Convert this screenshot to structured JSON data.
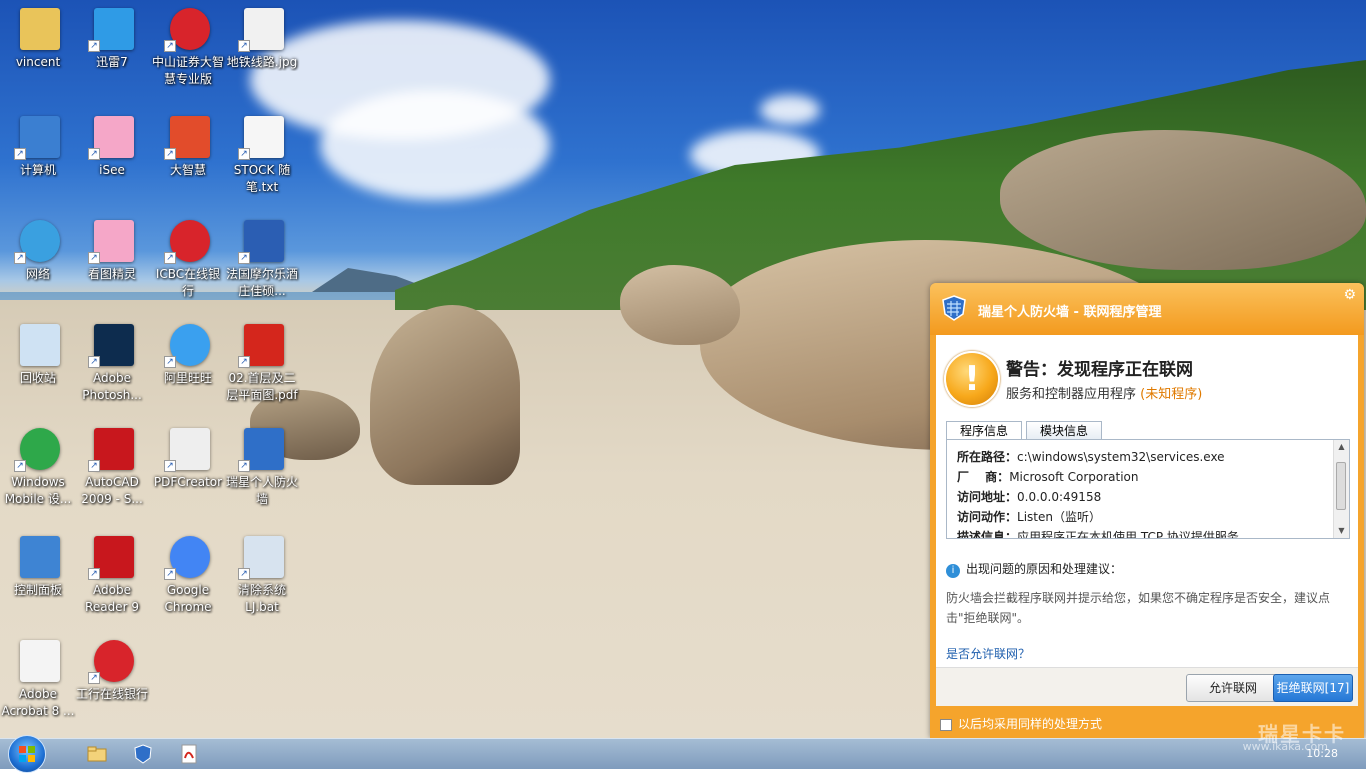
{
  "desktop": {
    "icons": [
      {
        "label": "vincent",
        "icon": "user-folder-icon"
      },
      {
        "label": "迅雷7",
        "icon": "thunder-bird-icon"
      },
      {
        "label": "中山证券大智慧专业版",
        "icon": "stock-app-icon"
      },
      {
        "label": "地铁线路.jpg",
        "icon": "image-file-icon"
      },
      {
        "label": "计算机",
        "icon": "computer-icon"
      },
      {
        "label": "iSee",
        "icon": "isee-icon"
      },
      {
        "label": "大智慧",
        "icon": "stock-chart-icon"
      },
      {
        "label": "STOCK 随笔.txt",
        "icon": "text-file-icon"
      },
      {
        "label": "网络",
        "icon": "network-icon"
      },
      {
        "label": "看图精灵",
        "icon": "image-viewer-icon"
      },
      {
        "label": "ICBC在线银行",
        "icon": "icbc-icon"
      },
      {
        "label": "法国摩尔乐酒庄佳硕...",
        "icon": "word-doc-icon"
      },
      {
        "label": "回收站",
        "icon": "recycle-bin-icon"
      },
      {
        "label": "Adobe Photosh...",
        "icon": "photoshop-icon"
      },
      {
        "label": "阿里旺旺",
        "icon": "aliwangwang-icon"
      },
      {
        "label": "02.首层及二层平面图.pdf",
        "icon": "pdf-file-icon"
      },
      {
        "label": "Windows Mobile 设...",
        "icon": "windows-mobile-icon"
      },
      {
        "label": "AutoCAD 2009 - S...",
        "icon": "autocad-icon"
      },
      {
        "label": "PDFCreator",
        "icon": "pdfcreator-icon"
      },
      {
        "label": "瑞星个人防火墙",
        "icon": "rising-firewall-icon"
      },
      {
        "label": "控制面板",
        "icon": "control-panel-icon"
      },
      {
        "label": "Adobe Reader 9",
        "icon": "adobe-reader-icon"
      },
      {
        "label": "Google Chrome",
        "icon": "chrome-icon"
      },
      {
        "label": "清除系统LJ.bat",
        "icon": "batch-file-icon"
      },
      {
        "label": "Adobe Acrobat 8 ...",
        "icon": "acrobat-icon"
      },
      {
        "label": "工行在线银行",
        "icon": "icbc-online-icon"
      }
    ]
  },
  "firewall": {
    "title": "瑞星个人防火墙 - 联网程序管理",
    "warning_title": "警告：发现程序正在联网",
    "warning_sub": "服务和控制器应用程序",
    "warning_sub_tag": "(未知程序)",
    "tabs": [
      "程序信息",
      "模块信息"
    ],
    "info": [
      {
        "key": "所在路径：",
        "value": "c:\\windows\\system32\\services.exe"
      },
      {
        "key": "厂　 商：",
        "value": "Microsoft Corporation"
      },
      {
        "key": "访问地址：",
        "value": "0.0.0.0:49158"
      },
      {
        "key": "访问动作：",
        "value": "Listen（监听）"
      },
      {
        "key": "描述信息：",
        "value": "应用程序正在本机使用 TCP 协议提供服务"
      }
    ],
    "reason_title": "出现问题的原因和处理建议：",
    "reason_text": "防火墙会拦截程序联网并提示给您，如果您不确定程序是否安全，建议点击\"拒绝联网\"。",
    "allow_question": "是否允许联网？",
    "allow_button": "允许联网",
    "deny_button": "拒绝联网[17]",
    "checkbox_label": "以后均采用同样的处理方式"
  },
  "taskbar": {
    "time": "10:28",
    "items": [
      "explorer-icon",
      "rising-firewall-icon",
      "pdf-icon"
    ]
  },
  "watermark": {
    "brand": "瑞星卡卡",
    "url": "www.ikaka.com"
  }
}
